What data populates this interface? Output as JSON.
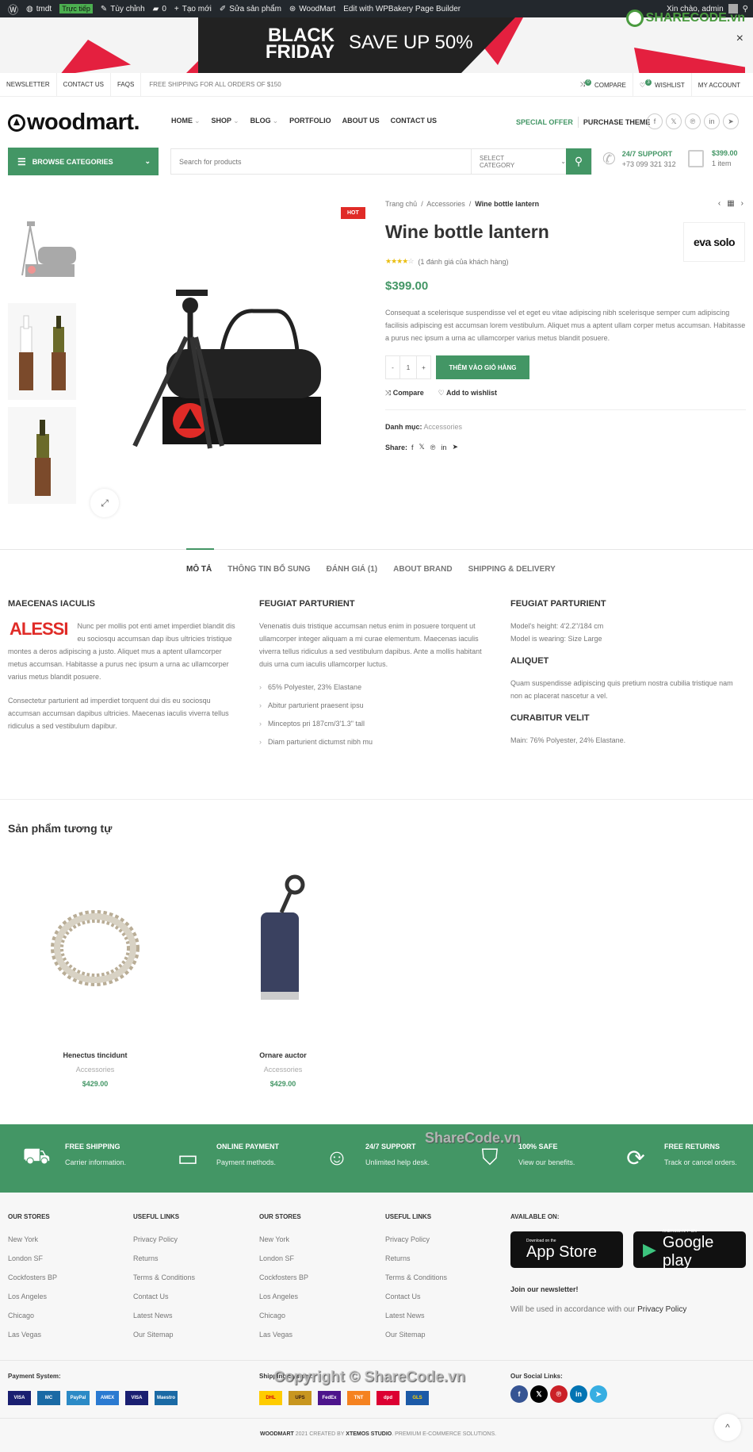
{
  "admin_bar": {
    "site": "tmdt",
    "live_badge": "Trực tiếp",
    "customize": "Tùy chỉnh",
    "comments": "0",
    "new": "Tạo mới",
    "edit_product": "Sửa sản phẩm",
    "theme": "WoodMart",
    "builder": "Edit with WPBakery Page Builder",
    "greeting": "Xin chào, admin"
  },
  "promo": {
    "line1": "BLACK",
    "line2": "FRIDAY",
    "offer": "SAVE UP 50%",
    "close": "×"
  },
  "watermark": {
    "logo": "SHARECODE.vn",
    "center": "ShareCode.vn",
    "copyright": "Copyright © ShareCode.vn"
  },
  "topbar": {
    "links": [
      "NEWSLETTER",
      "CONTACT US",
      "FAQS"
    ],
    "shipping": "FREE SHIPPING FOR ALL ORDERS OF $150",
    "compare": "COMPARE",
    "compare_count": "0",
    "wishlist": "WISHLIST",
    "wishlist_count": "3",
    "account": "MY ACCOUNT"
  },
  "header": {
    "logo": "woodmart.",
    "nav": [
      "HOME",
      "SHOP",
      "BLOG",
      "PORTFOLIO",
      "ABOUT US",
      "CONTACT US"
    ],
    "special_offer": "SPECIAL OFFER",
    "purchase": "PURCHASE THEME",
    "browse": "BROWSE CATEGORIES",
    "search_placeholder": "Search for products",
    "select_category": "SELECT CATEGORY",
    "support_title": "24/7 SUPPORT",
    "support_phone": "+73 099 321 312",
    "cart_total": "$399.00",
    "cart_items": "1 item"
  },
  "product": {
    "badge": "HOT",
    "breadcrumb": [
      "Trang chủ",
      "Accessories",
      "Wine bottle lantern"
    ],
    "title": "Wine bottle lantern",
    "brand": "eva solo",
    "rating": 4,
    "rating_max": 5,
    "reviews": "(1 đánh giá của khách hàng)",
    "price": "$399.00",
    "description": "Consequat a scelerisque suspendisse vel et eget eu vitae adipiscing nibh scelerisque semper cum adipiscing facilisis adipiscing est accumsan lorem vestibulum. Aliquet mus a aptent ullam corper metus accumsan. Habitasse a purus nec ipsum a urna ac ullamcorper varius metus blandit posuere.",
    "qty": "1",
    "minus": "-",
    "plus": "+",
    "add_to_cart": "THÊM VÀO GIỎ HÀNG",
    "compare": "Compare",
    "wishlist": "Add to wishlist",
    "category_label": "Danh mục:",
    "category": "Accessories",
    "share_label": "Share:"
  },
  "tabs": [
    "MÔ TẢ",
    "THÔNG TIN BỔ SUNG",
    "ĐÁNH GIÁ (1)",
    "ABOUT BRAND",
    "SHIPPING & DELIVERY"
  ],
  "description": {
    "col1": {
      "title": "MAECENAS IACULIS",
      "logo": "ALESSI",
      "p1": "Nunc per mollis pot enti amet imperdiet blandit dis eu sociosqu accumsan dap ibus ultricies tristique montes a deros adipiscing a justo. Aliquet mus a aptent ullamcorper metus accumsan. Habitasse a purus nec ipsum a urna ac ullamcorper varius metus blandit posuere.",
      "p2": "Consectetur parturient ad imperdiet torquent dui dis eu sociosqu accumsan accumsan dapibus ultricies. Maecenas iaculis viverra tellus ridiculus a sed vestibulum dapibur."
    },
    "col2": {
      "title": "FEUGIAT PARTURIENT",
      "p": "Venenatis duis tristique accumsan netus enim in posuere torquent ut ullamcorper integer aliquam a mi curae elementum. Maecenas iaculis viverra tellus ridiculus a sed vestibulum dapibus. Ante a mollis habitant duis urna cum iaculis ullamcorper luctus.",
      "list": [
        "65% Polyester, 23% Elastane",
        "Abitur parturient praesent ipsu",
        "Minceptos pri 187cm/3'1.3\" tall",
        "Diam parturient dictumst nibh mu"
      ]
    },
    "col3": {
      "title": "FEUGIAT PARTURIENT",
      "l1": "Model's height: 4'2.2\"/184 cm",
      "l2": "Model is wearing: Size Large",
      "title2": "ALIQUET",
      "p2": "Quam suspendisse adipiscing quis pretium nostra cubilia tristique nam non ac placerat nascetur a vel.",
      "title3": "CURABITUR VELIT",
      "p3": "Main: 76% Polyester, 24% Elastane."
    }
  },
  "related": {
    "title": "Sản phẩm tương tự",
    "items": [
      {
        "name": "Henectus tincidunt",
        "category": "Accessories",
        "price": "$429.00"
      },
      {
        "name": "Ornare auctor",
        "category": "Accessories",
        "price": "$429.00"
      }
    ]
  },
  "features": [
    {
      "title": "FREE SHIPPING",
      "sub": "Carrier information."
    },
    {
      "title": "ONLINE PAYMENT",
      "sub": "Payment methods."
    },
    {
      "title": "24/7 SUPPORT",
      "sub": "Unlimited help desk."
    },
    {
      "title": "100% SAFE",
      "sub": "View our benefits."
    },
    {
      "title": "FREE RETURNS",
      "sub": "Track or cancel orders."
    }
  ],
  "footer": {
    "columns": [
      {
        "title": "OUR STORES",
        "links": [
          "New York",
          "London SF",
          "Cockfosters BP",
          "Los Angeles",
          "Chicago",
          "Las Vegas"
        ]
      },
      {
        "title": "USEFUL LINKS",
        "links": [
          "Privacy Policy",
          "Returns",
          "Terms & Conditions",
          "Contact Us",
          "Latest News",
          "Our Sitemap"
        ]
      },
      {
        "title": "OUR STORES",
        "links": [
          "New York",
          "London SF",
          "Cockfosters BP",
          "Los Angeles",
          "Chicago",
          "Las Vegas"
        ]
      },
      {
        "title": "USEFUL LINKS",
        "links": [
          "Privacy Policy",
          "Returns",
          "Terms & Conditions",
          "Contact Us",
          "Latest News",
          "Our Sitemap"
        ]
      }
    ],
    "available_on": "AVAILABLE ON:",
    "appstore_small": "Download on the",
    "appstore_big": "App Store",
    "google_small": "ANDROID APP ON",
    "google_big": "Google play",
    "newsletter_title": "Join our newsletter!",
    "newsletter_text": "Will be used in accordance with our",
    "newsletter_link": "Privacy Policy",
    "payment_label": "Payment System:",
    "payments": [
      "VISA",
      "MC",
      "PayPal",
      "AMEX",
      "VISA",
      "Maestro"
    ],
    "shipping_label": "Shipping System:",
    "shippers": [
      "DHL",
      "UPS",
      "FedEx",
      "TNT",
      "dpd",
      "GLS"
    ],
    "social_label": "Our Social Links:",
    "copyright_brand": "WOODMART",
    "copyright_mid": "2021 CREATED BY",
    "copyright_studio": "XTEMOS STUDIO",
    "copyright_end": ". PREMIUM E-COMMERCE SOLUTIONS."
  },
  "colors": {
    "accent": "#439665",
    "hot": "#e02b27",
    "star": "#eabe12"
  }
}
